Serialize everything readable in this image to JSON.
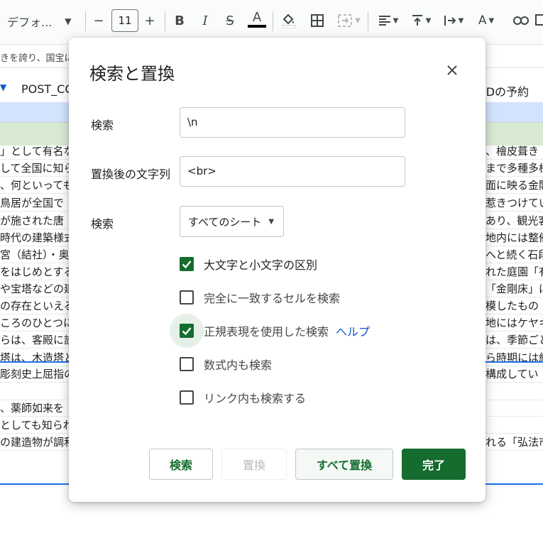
{
  "toolbar": {
    "font_name": "デフォ...",
    "font_size": "11",
    "minus": "−",
    "plus": "+",
    "bold": "B",
    "italic": "I",
    "strike": "S",
    "text_color": "A"
  },
  "formula_bar": {
    "text": "きを誇り、国宝に"
  },
  "sheet": {
    "header_left": "POST_CO",
    "header_right": "IDの予約",
    "rows": [
      {
        "l": "」として有名な",
        "r": "、檜皮葺き"
      },
      {
        "l": "して全国に知ら",
        "r": "まで多種多様"
      },
      {
        "l": "、何といっても",
        "r": "面に映る金閣"
      },
      {
        "l": "鳥居が全国で",
        "r": "惹きつけてい"
      },
      {
        "l": "が施された唐",
        "r": "あり、観光客"
      },
      {
        "l": "時代の建築様式",
        "r": "地内には整備"
      },
      {
        "l": "宮（結社）・奥",
        "r": "へと続く石段"
      },
      {
        "l": "をはじめとする",
        "r": "れた庭園「有"
      },
      {
        "l": "や宝塔などの建",
        "r": "「金剛床」は"
      },
      {
        "l": "の存在といえる",
        "r": "模したもの"
      },
      {
        "l": "ころのひとつに",
        "r": "地にはケヤキ"
      },
      {
        "l": "らは、客殿に設",
        "r": "は、季節ごと"
      },
      {
        "l": "塔は、木造塔と",
        "r": "ら時期には紅"
      },
      {
        "l": "彫刻史上屈指の",
        "r": "構成してい"
      },
      {
        "l": "",
        "r": ""
      },
      {
        "l": "、薬師如来を",
        "r": ""
      },
      {
        "l": "としても知られ",
        "r": ""
      },
      {
        "l": "の建造物が調和",
        "r": "れる「弘法市"
      }
    ]
  },
  "dialog": {
    "title": "検索と置換",
    "find_label": "検索",
    "find_value": "\\n",
    "replace_label": "置換後の文字列",
    "replace_value": "<br>",
    "scope_label": "検索",
    "scope_value": "すべてのシート",
    "options": [
      {
        "label": "大文字と小文字の区別",
        "checked": true
      },
      {
        "label": "完全に一致するセルを検索",
        "checked": false
      },
      {
        "label": "正規表現を使用した検索",
        "checked": true,
        "link": "ヘルプ"
      },
      {
        "label": "数式内も検索",
        "checked": false
      },
      {
        "label": "リンク内も検索する",
        "checked": false
      }
    ],
    "buttons": {
      "find": "検索",
      "replace": "置換",
      "replace_all": "すべて置換",
      "done": "完了"
    }
  },
  "colors": {
    "accent_green": "#146c2e",
    "link_blue": "#0b57d0",
    "selection_blue": "#d3e3fd"
  }
}
